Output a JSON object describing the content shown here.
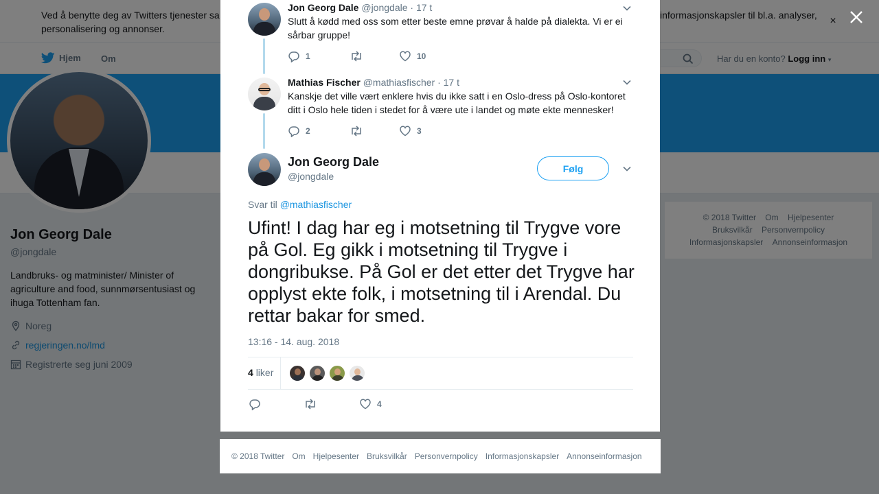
{
  "cookie_banner": {
    "text_left": "Ved å benytte deg av Twitters tjenester sa",
    "text_left_line2": "personalisering og annonser.",
    "text_right": "informasjonskapsler til bl.a. analyser,",
    "close_label": "×"
  },
  "nav": {
    "home": "Hjem",
    "about": "Om",
    "account_prompt": "Har du en konto?",
    "login": "Logg inn"
  },
  "profile": {
    "name": "Jon Georg Dale",
    "handle": "@jongdale",
    "bio": "Landbruks- og matminister/ Minister of agriculture and food, sunnmørsentusiast og ihuga Tottenham fan.",
    "location": "Noreg",
    "website": "regjeringen.no/lmd",
    "joined": "Registrerte seg juni 2009"
  },
  "side_footer": {
    "items": [
      "© 2018 Twitter",
      "Om",
      "Hjelpesenter",
      "Bruksvilkår",
      "Personvernpolicy",
      "Informasjonskapsler",
      "Annonseinformasjon"
    ]
  },
  "thread": [
    {
      "name": "Jon Georg Dale",
      "handle": "@jongdale",
      "time": "· 17 t",
      "text": "Slutt å kødd med oss som etter beste emne prøvar å halde på dialekta. Vi er ei sårbar gruppe!",
      "replies": "1",
      "retweets": "",
      "likes": "10"
    },
    {
      "name": "Mathias Fischer",
      "handle": "@mathiasfischer",
      "time": "· 17 t",
      "text": "Kanskje det ville vært enklere hvis du ikke satt i en Oslo-dress på Oslo-kontoret ditt i Oslo hele tiden i stedet for å være ute i landet og møte ekte mennesker!",
      "replies": "2",
      "retweets": "",
      "likes": "3"
    }
  ],
  "main_tweet": {
    "name": "Jon Georg Dale",
    "handle": "@jongdale",
    "follow_label": "Følg",
    "reply_prefix": "Svar til",
    "reply_mention": "@mathiasfischer",
    "text": "Ufint! I dag har eg i motsetning til Trygve vore på Gol. Eg gikk i motsetning til Trygve i dongribukse. På Gol er det etter det Trygve har opplyst ekte folk, i motsetning til i Arendal. Du rettar bakar for smed.",
    "timestamp": "13:16 - 14. aug. 2018",
    "likes_count": "4",
    "likes_label": "liker",
    "action_likes": "4"
  },
  "modal_footer": {
    "items": [
      "© 2018 Twitter",
      "Om",
      "Hjelpesenter",
      "Bruksvilkår",
      "Personvernpolicy",
      "Informasjonskapsler",
      "Annonseinformasjon"
    ]
  },
  "colors": {
    "accent": "#1da1f2",
    "link": "#1b95e0",
    "muted": "#657786",
    "thread_line": "#b3d9ec"
  }
}
